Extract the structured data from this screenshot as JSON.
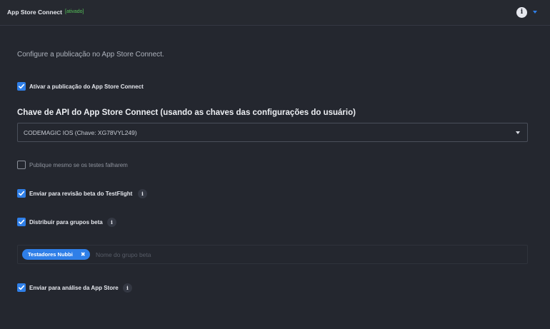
{
  "header": {
    "title": "App Store Connect",
    "status": "[ativado]",
    "info_icon": "info-icon",
    "collapse_icon": "chevron-down-icon"
  },
  "intro": "Configure a publicação no App Store Connect.",
  "enable_publishing": {
    "label": "Ativar a publicação do App Store Connect",
    "checked": true
  },
  "api_key": {
    "title": "Chave de API do App Store Connect (usando as chaves das configurações do usuário)",
    "selected": "CODEMAGIC IOS (Chave: XG78VYL249)"
  },
  "publish_on_fail": {
    "label": "Publique mesmo se os testes falharem",
    "checked": false
  },
  "testflight": {
    "label": "Enviar para revisão beta do TestFlight",
    "checked": true
  },
  "beta_groups": {
    "label": "Distribuir para grupos beta",
    "checked": true,
    "tags": [
      "Testadores Nubbi"
    ],
    "remove_glyph": "✖",
    "placeholder": "Nome do grupo beta"
  },
  "app_store_review": {
    "label": "Enviar para análise da App Store",
    "checked": true
  },
  "colors": {
    "accent": "#2f7fe8",
    "background": "#24272f",
    "status": "#56c25a"
  }
}
